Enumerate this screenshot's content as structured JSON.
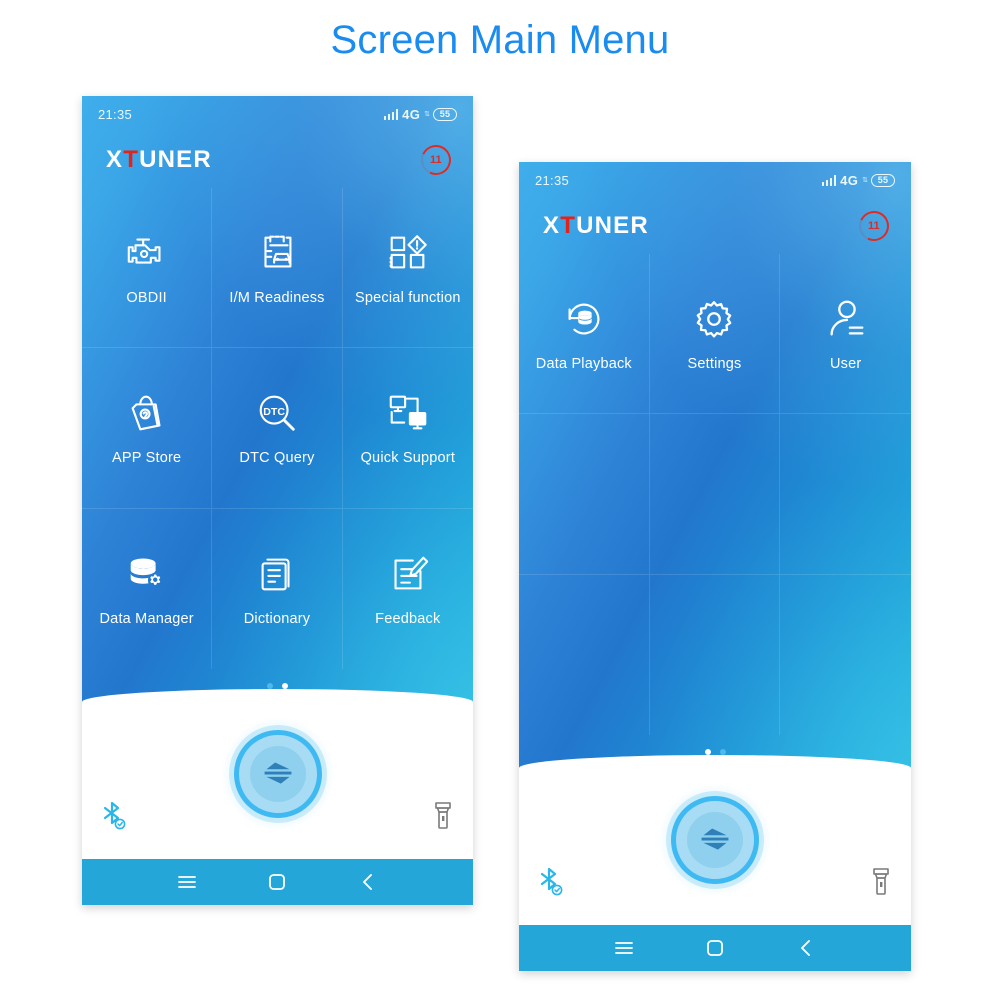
{
  "page": {
    "title": "Screen Main Menu",
    "title_color": "#1a8cf0",
    "background": "#ffffff"
  },
  "phones": [
    {
      "id": "phone-one",
      "status_bar": {
        "time": "21:35",
        "signal_icon": "signal-bars-icon",
        "network": "4G",
        "data_arrows_icon": "data-transfer-icon",
        "battery_level": "55"
      },
      "header": {
        "brand_prefix": "X",
        "brand_accent": "T",
        "brand_suffix": "UNER",
        "brand_accent_color": "#e32219",
        "notification_badge": "11",
        "notification_badge_color": "#e02a22"
      },
      "grid": [
        {
          "label": "OBDII",
          "icon": "engine-icon"
        },
        {
          "label": "I/M Readiness",
          "icon": "clipboard-car-icon"
        },
        {
          "label": "Special function",
          "icon": "special-function-icon"
        },
        {
          "label": "APP Store",
          "icon": "shopping-bag-icon"
        },
        {
          "label": "DTC Query",
          "icon": "dtc-magnifier-icon"
        },
        {
          "label": "Quick Support",
          "icon": "remote-support-icon"
        },
        {
          "label": "Data Manager",
          "icon": "database-gear-icon"
        },
        {
          "label": "Dictionary",
          "icon": "document-icon"
        },
        {
          "label": "Feedback",
          "icon": "document-pencil-icon"
        }
      ],
      "page_dots": [
        {
          "state": "inactive"
        },
        {
          "state": "active"
        }
      ],
      "connect": {
        "icon": "connect-swap-icon",
        "ring_color": "#3fb9f2",
        "bluetooth_icon": "bluetooth-connected-icon",
        "bluetooth_color": "#2ab6e8",
        "torch_icon": "flashlight-icon",
        "torch_color": "#7a7a7a"
      },
      "navbar": [
        {
          "icon": "menu-icon"
        },
        {
          "icon": "home-square-icon"
        },
        {
          "icon": "back-chevron-icon"
        }
      ]
    },
    {
      "id": "phone-two",
      "status_bar": {
        "time": "21:35",
        "signal_icon": "signal-bars-icon",
        "network": "4G",
        "data_arrows_icon": "data-transfer-icon",
        "battery_level": "55"
      },
      "header": {
        "brand_prefix": "X",
        "brand_accent": "T",
        "brand_suffix": "UNER",
        "brand_accent_color": "#e32219",
        "notification_badge": "11",
        "notification_badge_color": "#e02a22"
      },
      "grid": [
        {
          "label": "Data Playback",
          "icon": "data-playback-icon"
        },
        {
          "label": "Settings",
          "icon": "gear-icon"
        },
        {
          "label": "User",
          "icon": "user-icon"
        },
        {
          "label": "",
          "icon": ""
        },
        {
          "label": "",
          "icon": ""
        },
        {
          "label": "",
          "icon": ""
        },
        {
          "label": "",
          "icon": ""
        },
        {
          "label": "",
          "icon": ""
        },
        {
          "label": "",
          "icon": ""
        }
      ],
      "page_dots": [
        {
          "state": "active"
        },
        {
          "state": "inactive"
        }
      ],
      "connect": {
        "icon": "connect-swap-icon",
        "ring_color": "#3fb9f2",
        "bluetooth_icon": "bluetooth-connected-icon",
        "bluetooth_color": "#2ab6e8",
        "torch_icon": "flashlight-icon",
        "torch_color": "#7a7a7a"
      },
      "navbar": [
        {
          "icon": "menu-icon"
        },
        {
          "icon": "home-square-icon"
        },
        {
          "icon": "back-chevron-icon"
        }
      ]
    }
  ]
}
